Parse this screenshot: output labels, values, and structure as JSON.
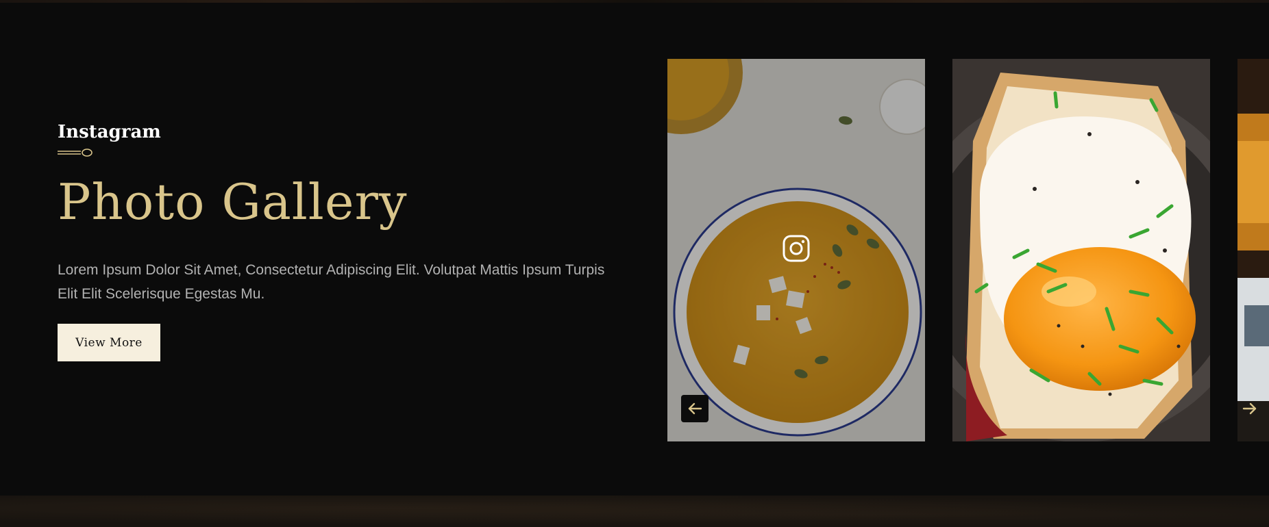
{
  "section": {
    "eyebrow": "Instagram",
    "title": "Photo Gallery",
    "description": "Lorem Ipsum Dolor Sit Amet, Consectetur Adipiscing Elit. Volutpat Mattis Ipsum Turpis Elit Elit Scelerisque Egestas Mu.",
    "button_label": "View More"
  },
  "gallery": {
    "items": [
      {
        "icon": "soup-photo",
        "overlay_icon": "instagram-icon"
      },
      {
        "icon": "fried-egg-toast-photo"
      },
      {
        "icon": "partial-food-photo"
      }
    ],
    "prev_icon": "arrow-left-icon",
    "next_icon": "arrow-right-icon"
  },
  "colors": {
    "background": "#0b0b0b",
    "accent_gold": "#d9c58b",
    "button_bg": "#f6efde",
    "body_text": "#b2b2b2"
  }
}
